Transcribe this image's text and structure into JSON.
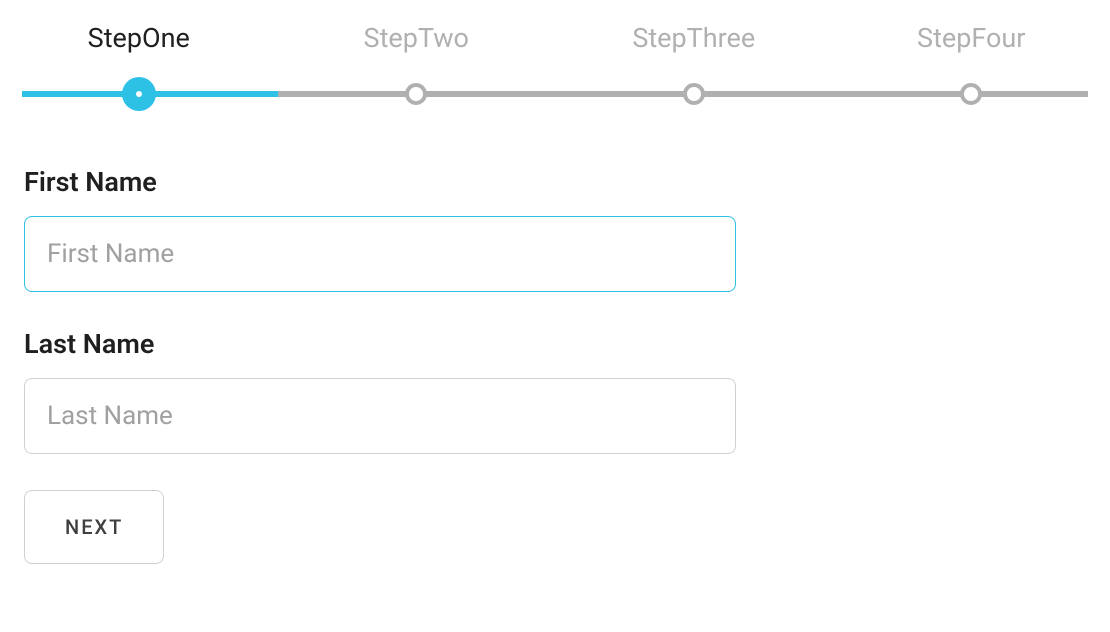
{
  "stepper": {
    "steps": [
      {
        "label": "StepOne",
        "active": true
      },
      {
        "label": "StepTwo",
        "active": false
      },
      {
        "label": "StepThree",
        "active": false
      },
      {
        "label": "StepFour",
        "active": false
      }
    ]
  },
  "form": {
    "first_name": {
      "label": "First Name",
      "placeholder": "First Name",
      "value": "",
      "focused": true
    },
    "last_name": {
      "label": "Last Name",
      "placeholder": "Last Name",
      "value": "",
      "focused": false
    },
    "next_button": "NEXT"
  }
}
